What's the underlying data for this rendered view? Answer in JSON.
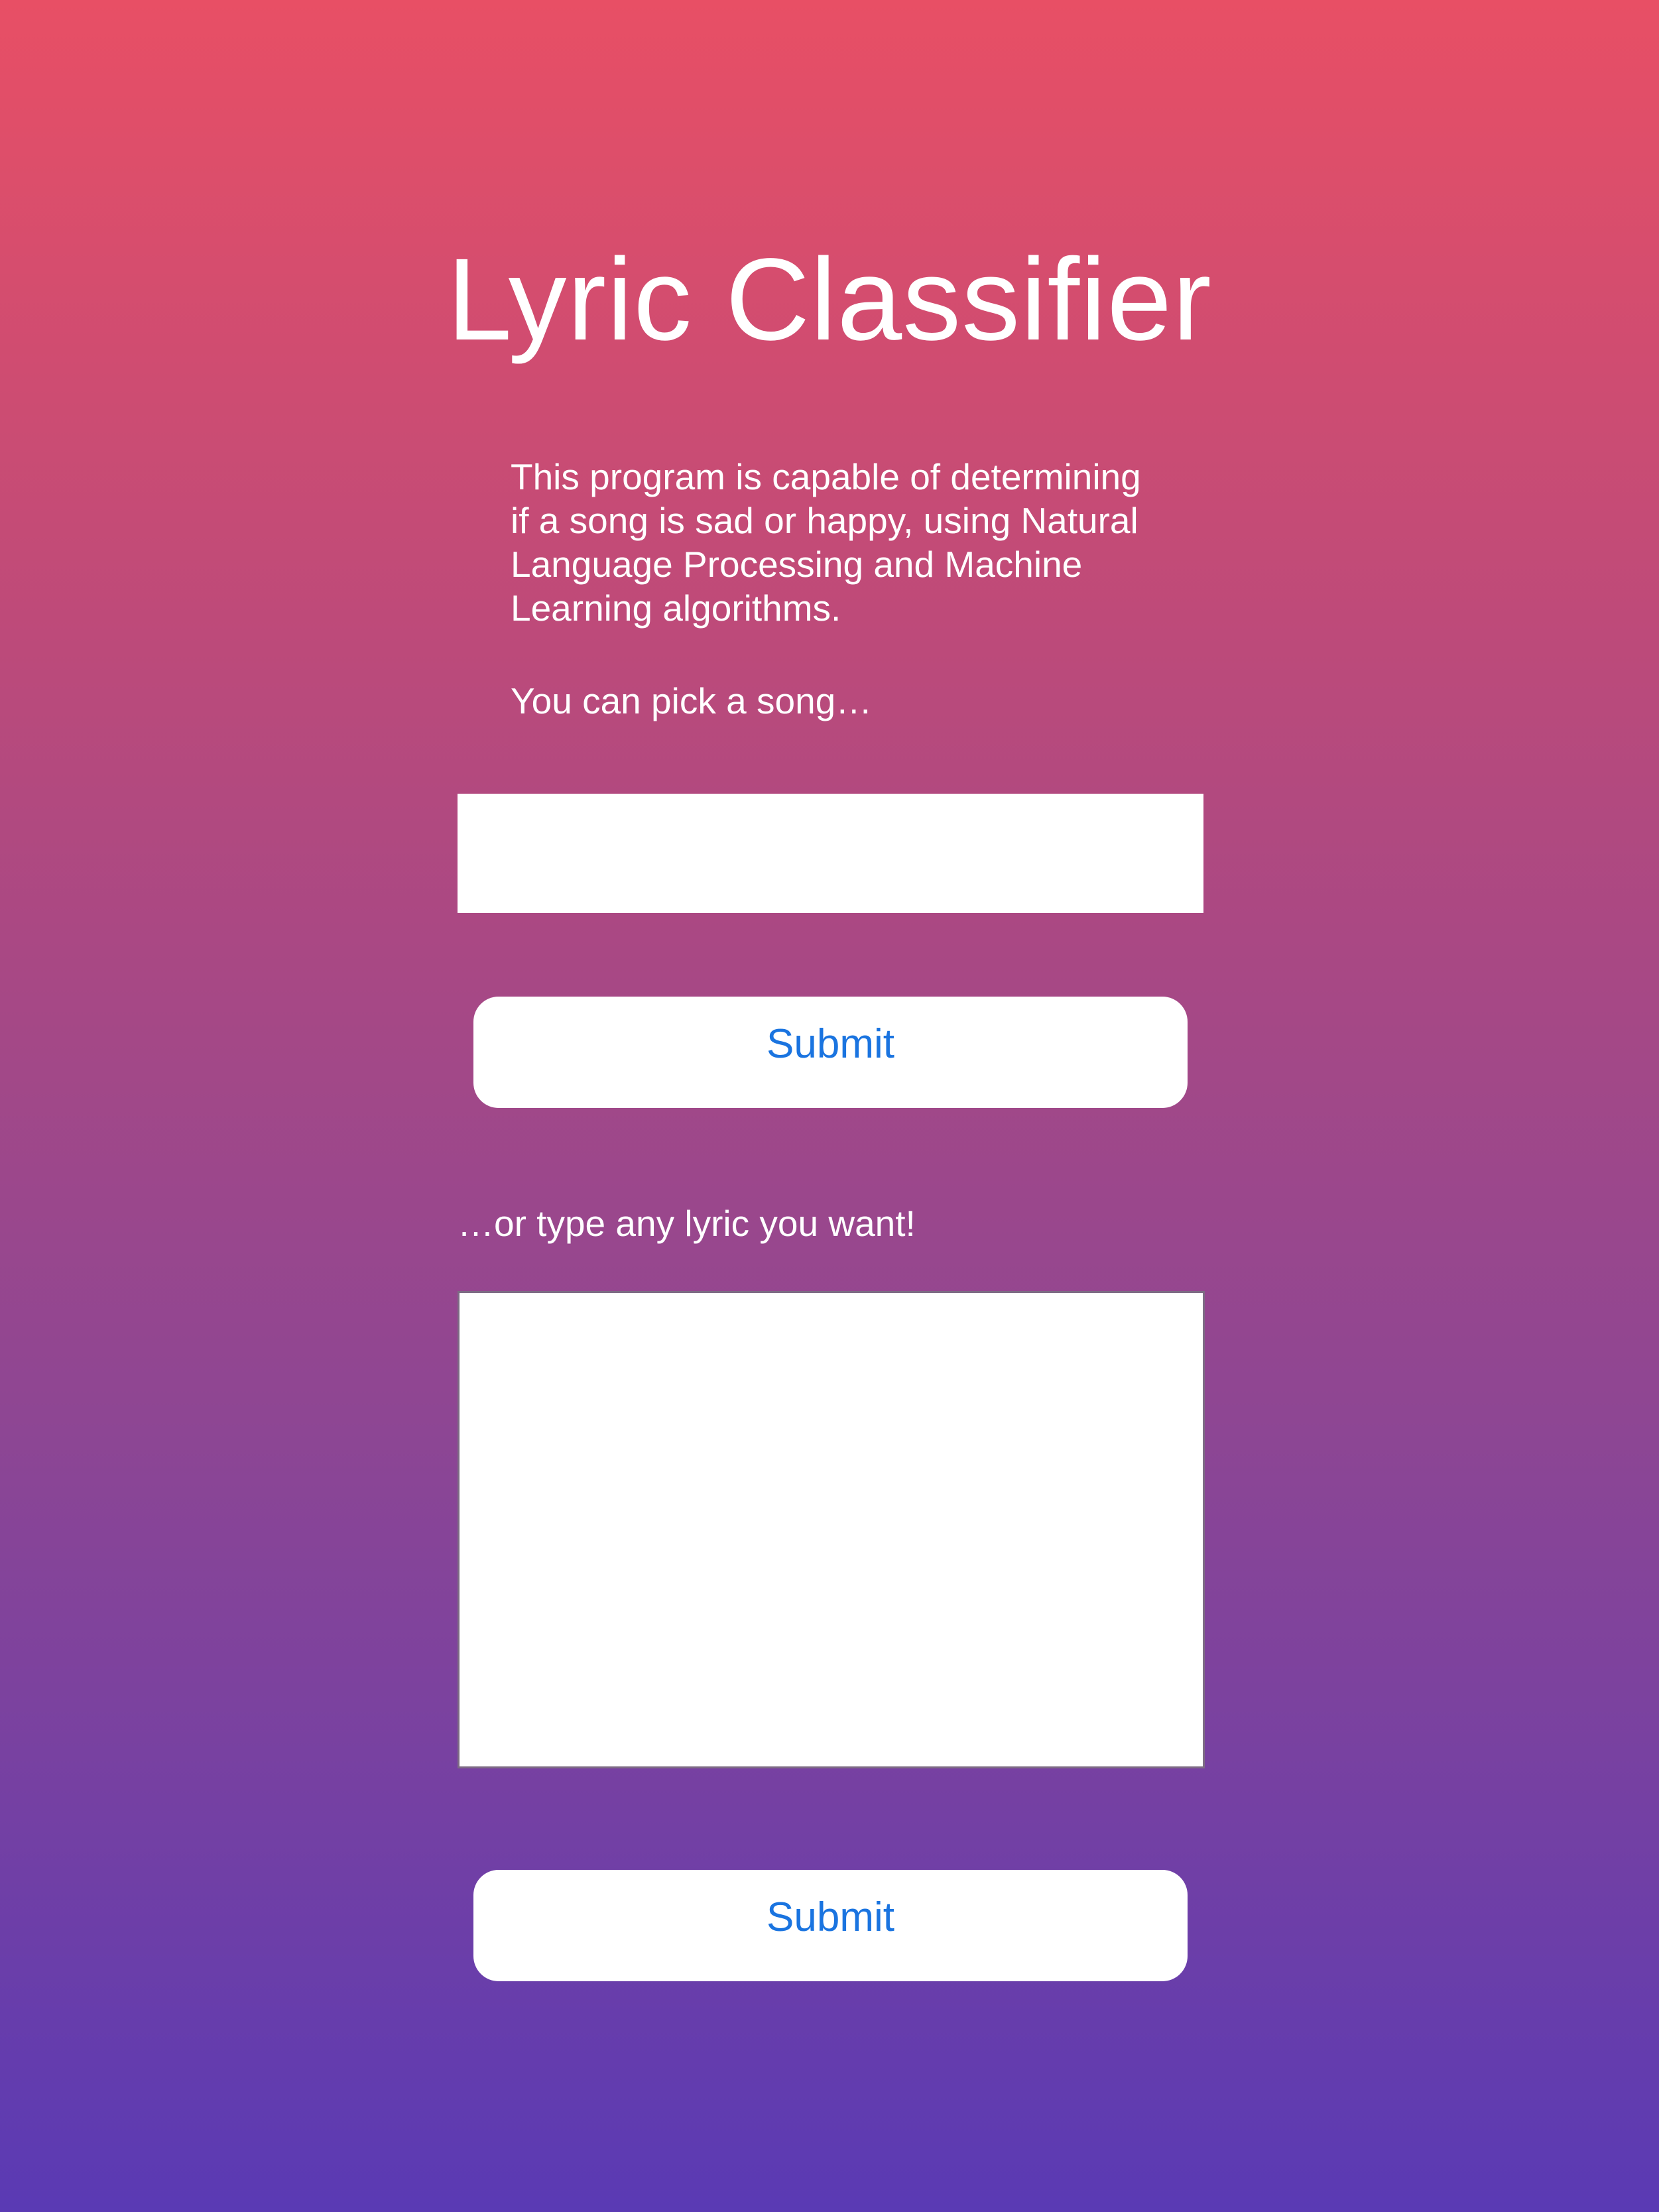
{
  "header": {
    "title": "Lyric Classifier"
  },
  "intro": {
    "description": "This program is capable of determining if a song is sad or happy, using Natural Language Processing and Machine Learning algorithms.",
    "pick_prompt": "You can pick a song…"
  },
  "song_form": {
    "selected_value": "",
    "submit_label": "Submit"
  },
  "lyric_form": {
    "prompt": "…or type any lyric you want!",
    "value": "",
    "submit_label": "Submit"
  },
  "colors": {
    "gradient_top": "#e84f65",
    "gradient_bottom": "#5a3ab4",
    "button_text": "#1a74e0"
  }
}
